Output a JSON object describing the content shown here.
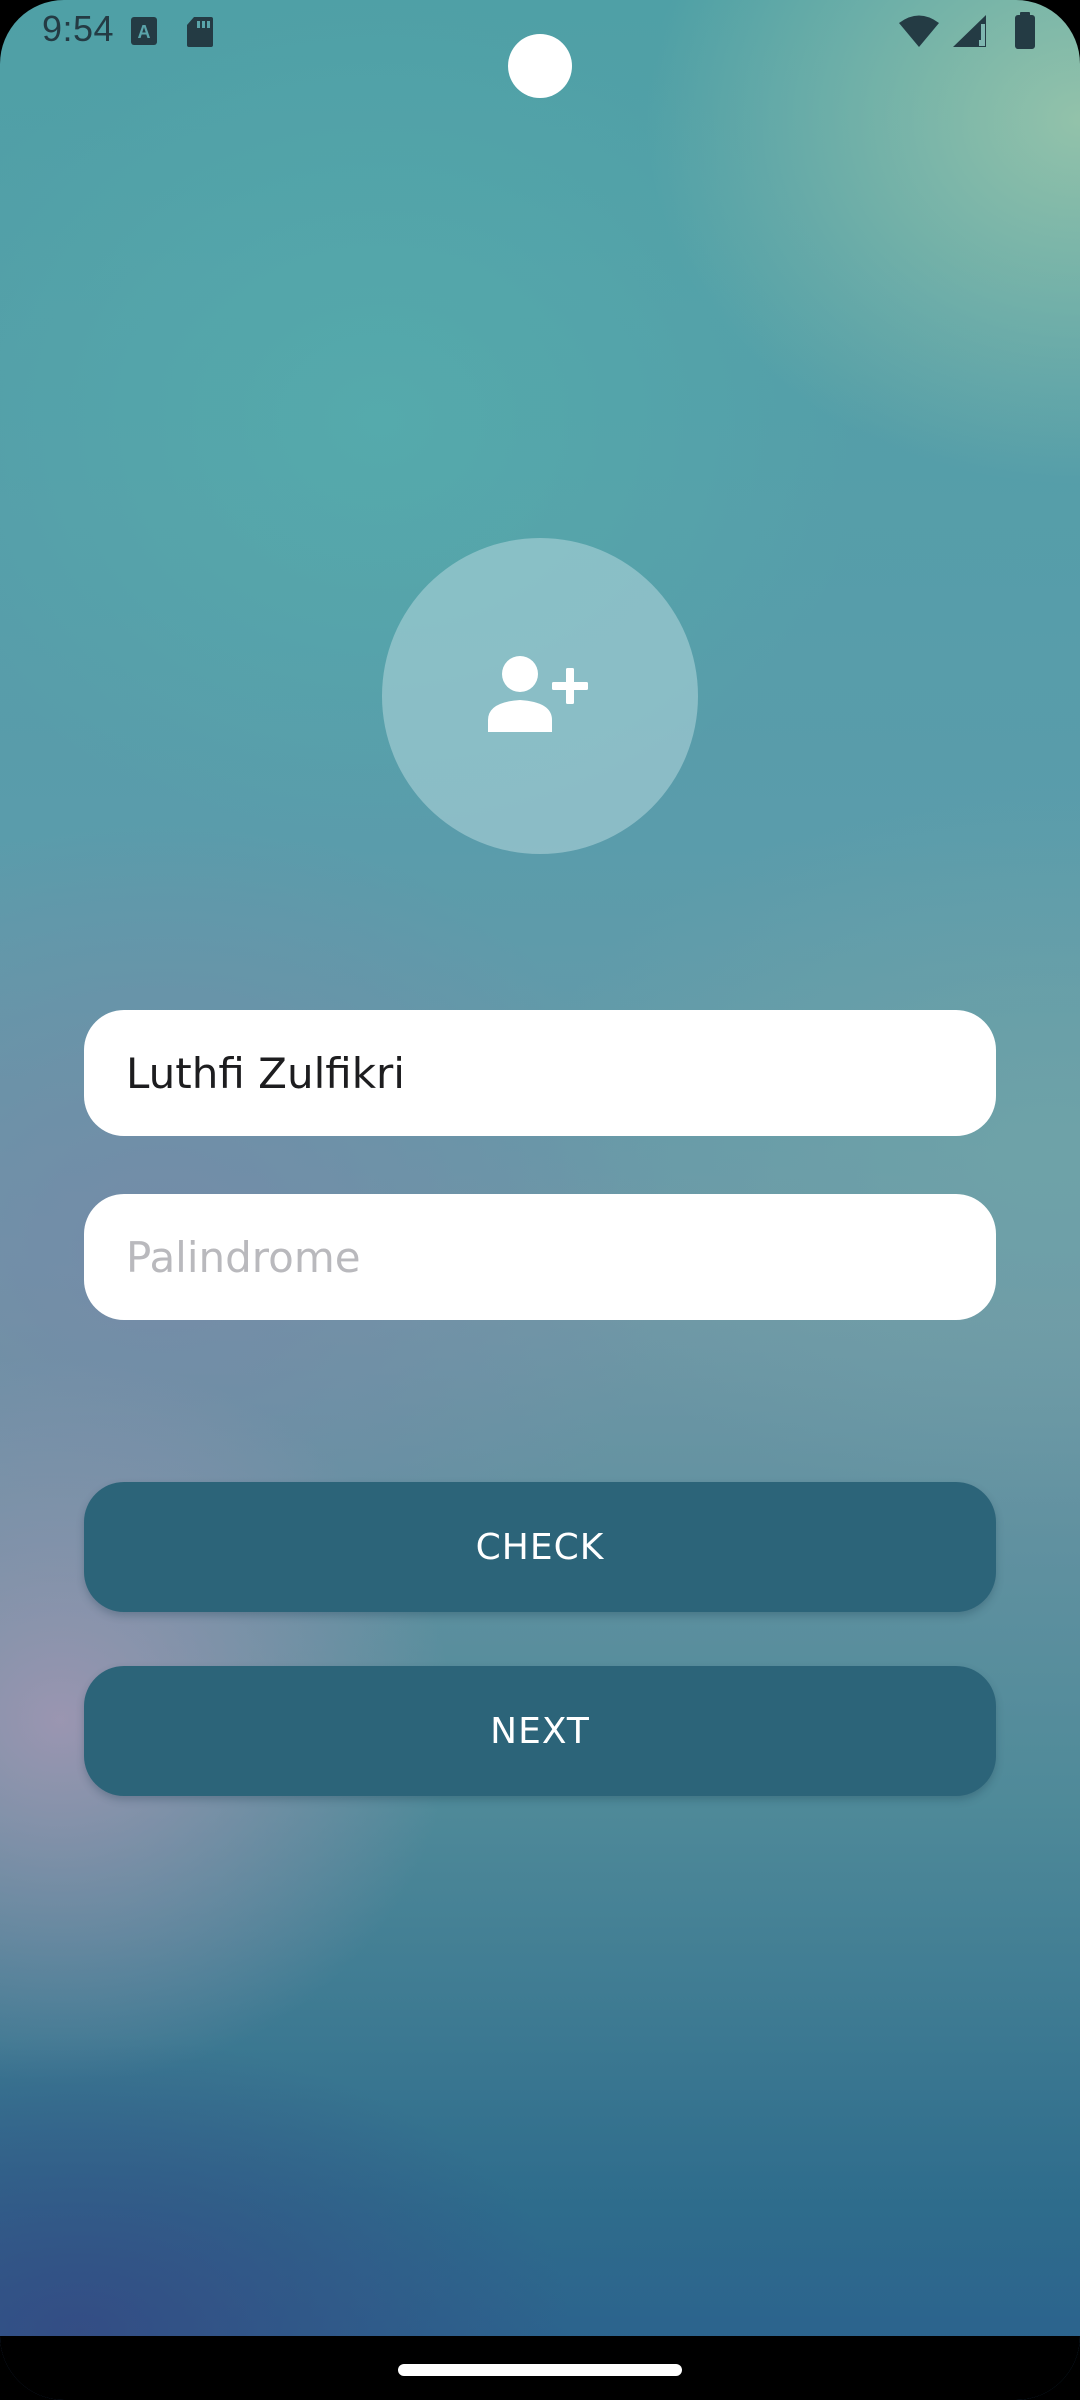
{
  "status_bar": {
    "time": "9:54",
    "icons": [
      "keyboard-a-icon",
      "sd-card-icon",
      "wifi-icon",
      "signal-icon",
      "battery-icon"
    ]
  },
  "avatar": {
    "icon": "add-person-icon"
  },
  "form": {
    "name_value": "Luthfi Zulfikri",
    "palindrome_placeholder": "Palindrome",
    "palindrome_value": ""
  },
  "actions": {
    "check_label": "CHECK",
    "next_label": "NEXT"
  },
  "colors": {
    "button": "#2c6479",
    "field": "#ffffff",
    "placeholder": "#b9b9bd",
    "text": "#1d1d1f"
  }
}
